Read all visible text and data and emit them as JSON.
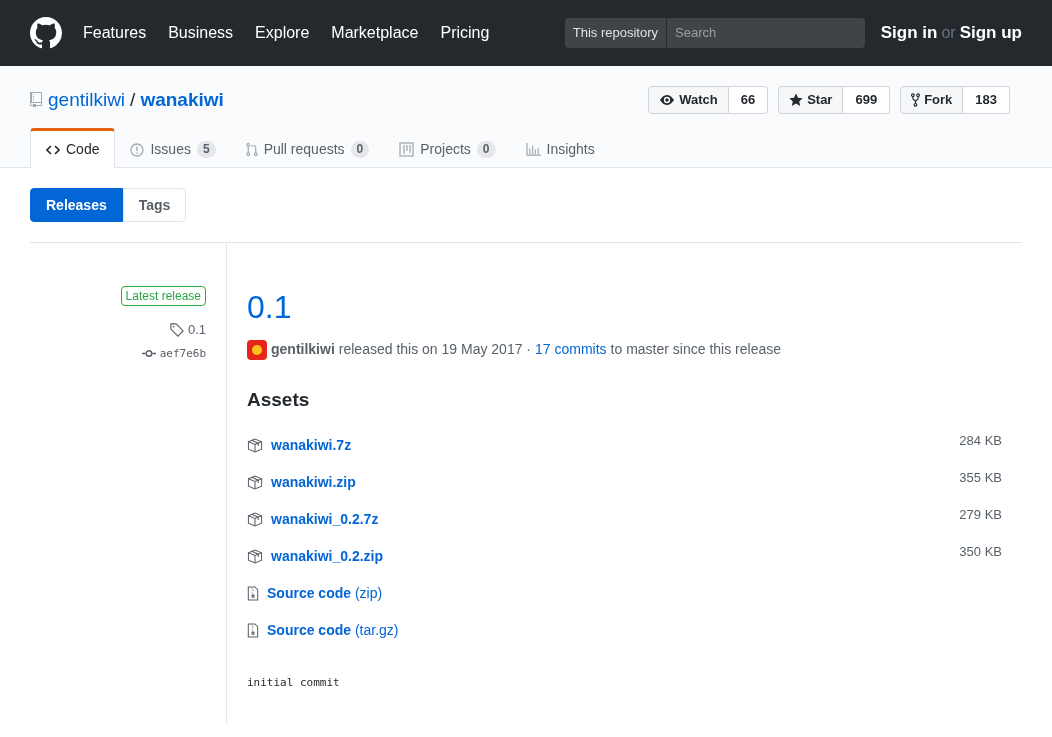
{
  "header": {
    "nav": [
      "Features",
      "Business",
      "Explore",
      "Marketplace",
      "Pricing"
    ],
    "scope": "This repository",
    "search": {
      "placeholder": "Search"
    },
    "sign_in": "Sign in",
    "or": "or",
    "sign_up": "Sign up"
  },
  "repo": {
    "owner": "gentilkiwi",
    "separator": "/",
    "name": "wanakiwi"
  },
  "actions": [
    {
      "kind": "watch",
      "label": "Watch",
      "count": "66"
    },
    {
      "kind": "star",
      "label": "Star",
      "count": "699"
    },
    {
      "kind": "fork",
      "label": "Fork",
      "count": "183"
    }
  ],
  "tabs": [
    {
      "kind": "code",
      "label": "Code",
      "selected": true
    },
    {
      "kind": "issues",
      "label": "Issues",
      "count": "5",
      "selected": false
    },
    {
      "kind": "pulls",
      "label": "Pull requests",
      "count": "0",
      "selected": false
    },
    {
      "kind": "projects",
      "label": "Projects",
      "count": "0",
      "selected": false
    },
    {
      "kind": "insights",
      "label": "Insights",
      "selected": false
    }
  ],
  "subnav": [
    {
      "label": "Releases",
      "selected": true
    },
    {
      "label": "Tags",
      "selected": false
    }
  ],
  "release": {
    "badge": "Latest release",
    "tag": "0.1",
    "commit": "aef7e6b",
    "title": "0.1",
    "author": "gentilkiwi",
    "released_text": "released this on 19 May 2017 ·",
    "commits_link": "17 commits",
    "commits_after": "to master since this release",
    "assets_heading": "Assets",
    "assets": [
      {
        "kind": "package",
        "name": "wanakiwi.7z",
        "size": "284 KB"
      },
      {
        "kind": "package",
        "name": "wanakiwi.zip",
        "size": "355 KB"
      },
      {
        "kind": "package",
        "name": "wanakiwi_0.2.7z",
        "size": "279 KB"
      },
      {
        "kind": "package",
        "name": "wanakiwi_0.2.zip",
        "size": "350 KB"
      },
      {
        "kind": "source",
        "name": "**Source code** (zip)"
      },
      {
        "kind": "source",
        "name": "**Source code** (tar.gz)"
      }
    ],
    "body": "initial commit"
  }
}
